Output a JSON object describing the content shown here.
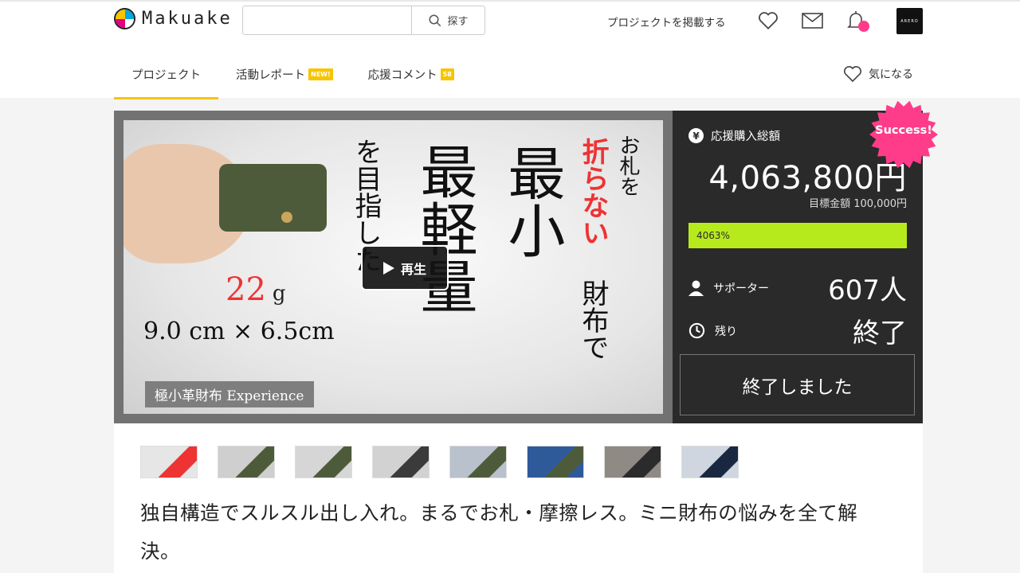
{
  "header": {
    "logo_text": "Makuake",
    "search_placeholder": "",
    "search_button": "探す",
    "post_project": "プロジェクトを掲載する",
    "avatar_text": "ARERO"
  },
  "tabs": [
    {
      "label": "プロジェクト",
      "badge": ""
    },
    {
      "label": "活動レポート",
      "badge": "NEW!"
    },
    {
      "label": "応援コメント",
      "badge": "58"
    }
  ],
  "favorite_label": "気になる",
  "hero": {
    "line_osatsu": "お札を",
    "line_oranai": "折らない",
    "line_zaifude": "財布で",
    "line_saisho": "最小",
    "line_saikeiryo": "最軽量",
    "line_mezashita": "を目指した",
    "weight_value": "22",
    "weight_unit": "g",
    "dimensions": "9.0 cm × 6.5cm",
    "label": "極小革財布 Experience",
    "play_label": "再生"
  },
  "stats": {
    "total_label": "応援購入総額",
    "total_amount": "4,063,800円",
    "goal": "目標金額 100,000円",
    "progress_text": "4063%",
    "progress_fraction": 1.0,
    "supporters_label": "サポーター",
    "supporters_value": "607人",
    "remaining_label": "残り",
    "remaining_value": "終了",
    "ended_button": "終了しました",
    "success_badge": "Success!",
    "progress_color": "#b7ea1d",
    "success_color": "#ff3c8a"
  },
  "thumbnails": [
    {
      "bg": "#e6e6e6",
      "accent": "#e33"
    },
    {
      "bg": "#cfcfcf",
      "accent": "#4d5b3a"
    },
    {
      "bg": "#d6d6d6",
      "accent": "#4d5b3a"
    },
    {
      "bg": "#d2d2d2",
      "accent": "#3b3b3b"
    },
    {
      "bg": "#b9c1cc",
      "accent": "#4d5b3a"
    },
    {
      "bg": "#2f5a9a",
      "accent": "#4d5b3a"
    },
    {
      "bg": "#8f8a83",
      "accent": "#2b2b2b"
    },
    {
      "bg": "#cfd6df",
      "accent": "#1a2740"
    }
  ],
  "tagline": "独自構造でスルスル出し入れ。まるでお札・摩擦レス。ミニ財布の悩みを全て解決。"
}
